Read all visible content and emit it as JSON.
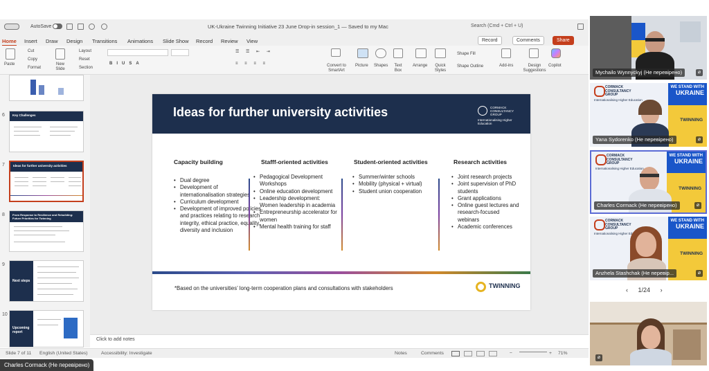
{
  "app": {
    "autosave_label": "AutoSave",
    "title": "UK-Ukraine Twinning Initiative 23 June Drop-in session_1 — Saved to my Mac",
    "search_placeholder": "Search (Cmd + Ctrl + U)"
  },
  "tabs": [
    "Home",
    "Insert",
    "Draw",
    "Design",
    "Transitions",
    "Animations",
    "Slide Show",
    "Record",
    "Review",
    "View"
  ],
  "ribbon": {
    "paste": "Paste",
    "cut": "Cut",
    "copy": "Copy",
    "format": "Format",
    "new_slide": "New Slide",
    "layout": "Layout",
    "reset": "Reset",
    "section": "Section",
    "convert": "Convert to SmartArt",
    "picture": "Picture",
    "shapes": "Shapes",
    "textbox": "Text Box",
    "arrange": "Arrange",
    "quick_styles": "Quick Styles",
    "shape_fill": "Shape Fill",
    "shape_outline": "Shape Outline",
    "addins": "Add-ins",
    "design_suggestions": "Design Suggestions",
    "copilot": "Copilot",
    "record": "Record",
    "comments": "Comments",
    "share": "Share"
  },
  "thumbnails": [
    {
      "num": "6",
      "title": "Key Challenges"
    },
    {
      "num": "7",
      "title": "Ideas for further university activities"
    },
    {
      "num": "8",
      "title": "From Response to Resilience and Rebuilding: Future Priorities for Twinning"
    },
    {
      "num": "9",
      "title": "Next steps"
    },
    {
      "num": "10",
      "title": "Upcoming report"
    }
  ],
  "slide": {
    "title": "Ideas for further university activities",
    "logo_text": "CORMACK CONSULTANCY GROUP",
    "logo_sub": "Internationalising Higher Education",
    "columns": [
      {
        "heading": "Capacity building",
        "items": [
          "Dual degree",
          "Development of internationalisation strategies",
          "Curriculum development",
          "Development of improved policies and practices relating to research integrity, ethical practice, equality, diversity and inclusion"
        ]
      },
      {
        "heading": "Stafff-oriented activities",
        "items": [
          "Pedagogical Development Workshops",
          "Online education development",
          "Leadership development: Women leadership in academia",
          "Entrepreneurship accelerator for women",
          "Mental health training for staff"
        ]
      },
      {
        "heading": "Student-oriented activities",
        "items": [
          "Summer/winter schools",
          "Mobility (physical + virtual)",
          "Student union cooperation"
        ]
      },
      {
        "heading": "Research activities",
        "items": [
          "Joint research projects",
          "Joint supervision of PhD students",
          "Grant applications",
          "Online guest lectures and research-focused webinars",
          "Academic conferences"
        ]
      }
    ],
    "footnote": "*Based on the universities’ long-term cooperation plans and consultations with stakeholders",
    "twinning_logo": "TWINNING"
  },
  "notes_placeholder": "Click to add notes",
  "status": {
    "slide_of": "Slide 7 of 11",
    "language": "English (United States)",
    "accessibility": "Accessibility: Investigate",
    "notes": "Notes",
    "comments": "Comments",
    "zoom": "71%"
  },
  "participants": [
    {
      "name": "Mychailo Wynnyckyj (Не перевірено)"
    },
    {
      "name": "Yana Sydorenko (Не перевірено)"
    },
    {
      "name": "Charles Cormack (Не перевірено)"
    },
    {
      "name": "Anzhela Stashchak (Не перевір..."
    }
  ],
  "tile_branding": {
    "we_stand": "WE STAND WITH",
    "ukraine": "UKRAINE",
    "twinning": "TWINNING",
    "cc": "CORMACK CONSULTANCY GROUP",
    "cc_sub": "Internationalising Higher Education"
  },
  "pager": "1/24",
  "speaker_label": "Charles Cormack (Не перевірено)"
}
